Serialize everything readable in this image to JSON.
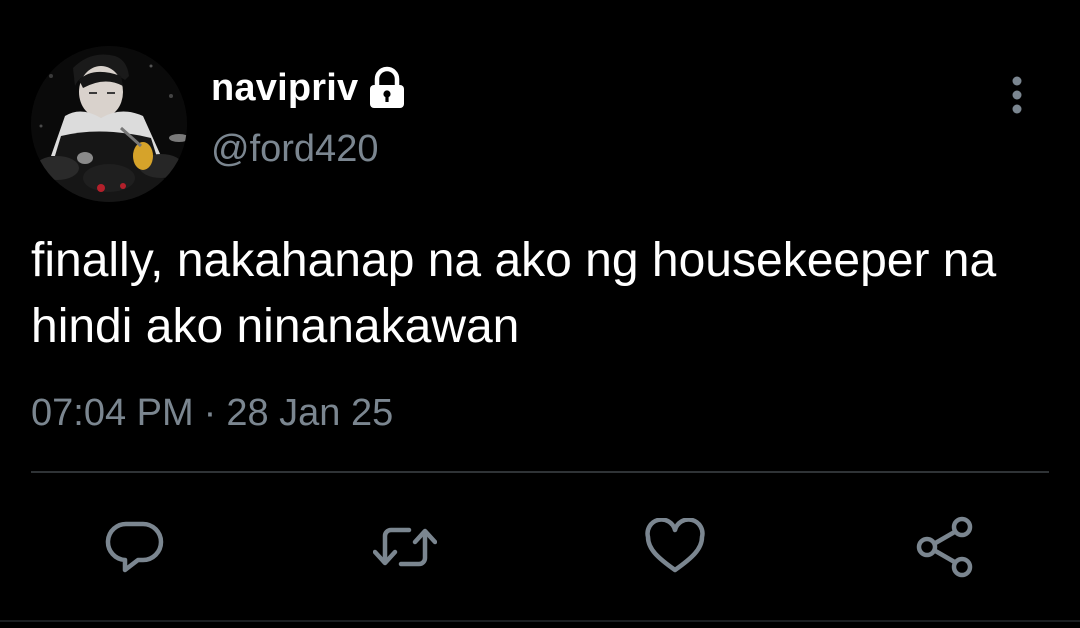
{
  "tweet": {
    "display_name": "navipriv",
    "handle": "@ford420",
    "text": "finally, nakahanap na ako ng housekeeper na hindi ako ninanakawan",
    "time": "07:04 PM",
    "separator": "·",
    "date": "28 Jan 25"
  },
  "icons": {
    "lock": "lock-icon",
    "more": "vertical-dots-icon",
    "reply": "speech-bubble-icon",
    "retweet": "retweet-arrows-icon",
    "like": "heart-icon",
    "share": "share-nodes-icon"
  },
  "colors": {
    "background": "#000000",
    "primary_text": "#ffffff",
    "secondary_text": "#7b8690",
    "divider": "#2f3336"
  }
}
